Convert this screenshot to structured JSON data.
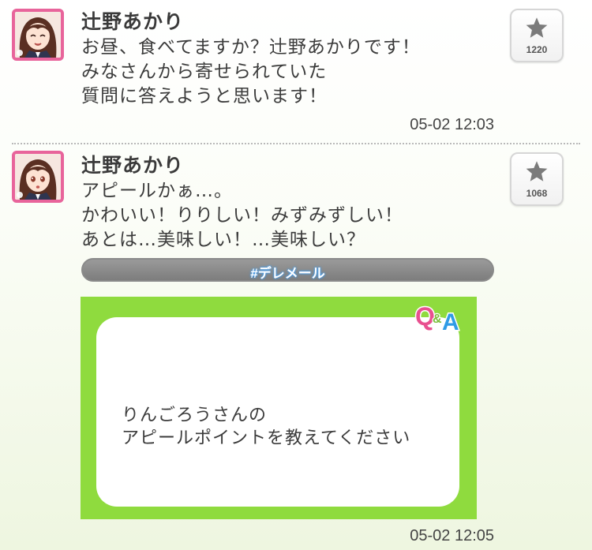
{
  "posts": [
    {
      "author": "辻野あかり",
      "lines": [
        "お昼、食べてますか？辻野あかりです！",
        "みなさんから寄せられていた",
        "質問に答えようと思います！"
      ],
      "favorites": "1220",
      "timestamp": "05-02 12:03",
      "icons": {
        "avatar": "avatar-smiling",
        "favorite": "star-icon"
      }
    },
    {
      "author": "辻野あかり",
      "lines": [
        "アピールかぁ…。",
        "かわいい！りりしい！みずみずしい！",
        "あとは…美味しい！…美味しい？"
      ],
      "favorites": "1068",
      "timestamp": "05-02 12:05",
      "hashtag": "#デレメール",
      "attachment": {
        "badge": "Q&A",
        "question_lines": [
          "りんごろうさんの",
          "アピールポイントを教えてください"
        ]
      },
      "icons": {
        "avatar": "avatar-talking",
        "favorite": "star-icon"
      }
    }
  ],
  "colors": {
    "avatar_border": "#e8649b",
    "card_green": "#8fdb3e",
    "hashtag_glow": "#3da3ff",
    "badge_q": "#e8508f",
    "badge_a": "#2f9be6"
  }
}
